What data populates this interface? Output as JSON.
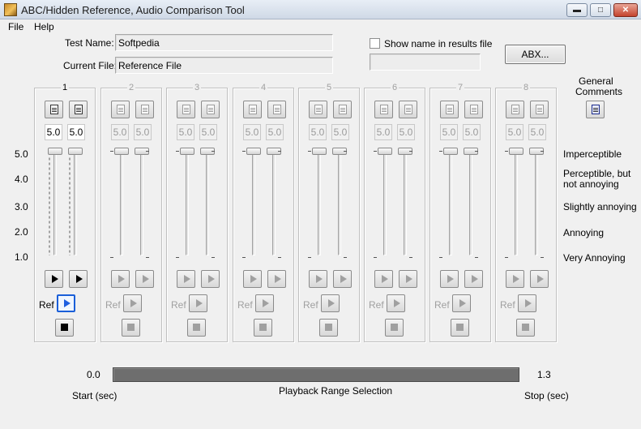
{
  "window": {
    "title": "ABC/Hidden Reference, Audio Comparison Tool",
    "minimize_glyph": "▬",
    "maximize_glyph": "□",
    "close_glyph": "✕"
  },
  "menu": {
    "file": "File",
    "help": "Help"
  },
  "test": {
    "name_label": "Test Name:",
    "name_value": "Softpedia",
    "file_label": "Current File:",
    "file_value": "Reference File"
  },
  "show_name": {
    "label": "Show name in results file",
    "checked": false,
    "value": ""
  },
  "abx_button": "ABX...",
  "general_comments": {
    "line1": "General",
    "line2": "Comments"
  },
  "scale": [
    "5.0",
    "4.0",
    "3.0",
    "2.0",
    "1.0"
  ],
  "ratings": {
    "r5": "Imperceptible",
    "r4a": "Perceptible, but",
    "r4b": "not annoying",
    "r3": "Slightly annoying",
    "r2": "Annoying",
    "r1": "Very Annoying"
  },
  "channels": [
    {
      "number": "1",
      "score_a": "5.0",
      "score_b": "5.0",
      "ref_label": "Ref",
      "enabled": true
    },
    {
      "number": "2",
      "score_a": "5.0",
      "score_b": "5.0",
      "ref_label": "Ref",
      "enabled": false
    },
    {
      "number": "3",
      "score_a": "5.0",
      "score_b": "5.0",
      "ref_label": "Ref",
      "enabled": false
    },
    {
      "number": "4",
      "score_a": "5.0",
      "score_b": "5.0",
      "ref_label": "Ref",
      "enabled": false
    },
    {
      "number": "5",
      "score_a": "5.0",
      "score_b": "5.0",
      "ref_label": "Ref",
      "enabled": false
    },
    {
      "number": "6",
      "score_a": "5.0",
      "score_b": "5.0",
      "ref_label": "Ref",
      "enabled": false
    },
    {
      "number": "7",
      "score_a": "5.0",
      "score_b": "5.0",
      "ref_label": "Ref",
      "enabled": false
    },
    {
      "number": "8",
      "score_a": "5.0",
      "score_b": "5.0",
      "ref_label": "Ref",
      "enabled": false
    }
  ],
  "playback": {
    "start_value": "0.0",
    "stop_value": "1.3",
    "start_label": "Start (sec)",
    "stop_label": "Stop (sec)",
    "title": "Playback Range Selection"
  },
  "colors": {
    "accent": "#1f5fe0",
    "range_bar": "#6e6e6e"
  }
}
